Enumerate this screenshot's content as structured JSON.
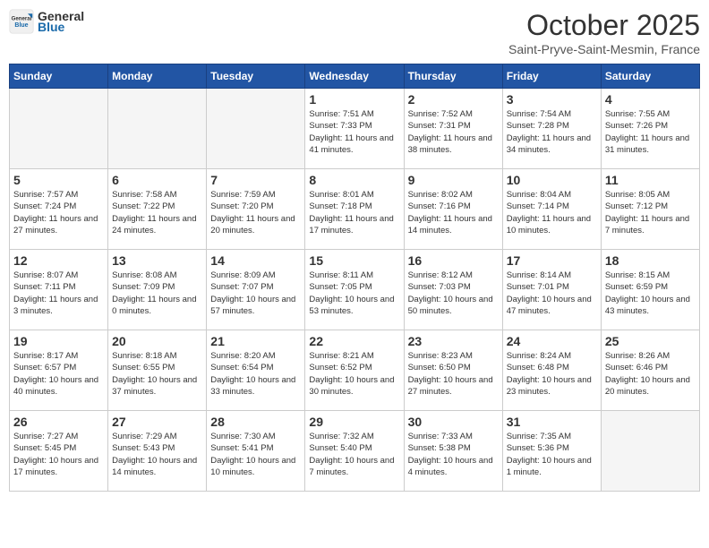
{
  "header": {
    "logo_general": "General",
    "logo_blue": "Blue",
    "title": "October 2025",
    "subtitle": "Saint-Pryve-Saint-Mesmin, France"
  },
  "days_of_week": [
    "Sunday",
    "Monday",
    "Tuesday",
    "Wednesday",
    "Thursday",
    "Friday",
    "Saturday"
  ],
  "weeks": [
    [
      {
        "num": "",
        "info": ""
      },
      {
        "num": "",
        "info": ""
      },
      {
        "num": "",
        "info": ""
      },
      {
        "num": "1",
        "info": "Sunrise: 7:51 AM\nSunset: 7:33 PM\nDaylight: 11 hours and 41 minutes."
      },
      {
        "num": "2",
        "info": "Sunrise: 7:52 AM\nSunset: 7:31 PM\nDaylight: 11 hours and 38 minutes."
      },
      {
        "num": "3",
        "info": "Sunrise: 7:54 AM\nSunset: 7:28 PM\nDaylight: 11 hours and 34 minutes."
      },
      {
        "num": "4",
        "info": "Sunrise: 7:55 AM\nSunset: 7:26 PM\nDaylight: 11 hours and 31 minutes."
      }
    ],
    [
      {
        "num": "5",
        "info": "Sunrise: 7:57 AM\nSunset: 7:24 PM\nDaylight: 11 hours and 27 minutes."
      },
      {
        "num": "6",
        "info": "Sunrise: 7:58 AM\nSunset: 7:22 PM\nDaylight: 11 hours and 24 minutes."
      },
      {
        "num": "7",
        "info": "Sunrise: 7:59 AM\nSunset: 7:20 PM\nDaylight: 11 hours and 20 minutes."
      },
      {
        "num": "8",
        "info": "Sunrise: 8:01 AM\nSunset: 7:18 PM\nDaylight: 11 hours and 17 minutes."
      },
      {
        "num": "9",
        "info": "Sunrise: 8:02 AM\nSunset: 7:16 PM\nDaylight: 11 hours and 14 minutes."
      },
      {
        "num": "10",
        "info": "Sunrise: 8:04 AM\nSunset: 7:14 PM\nDaylight: 11 hours and 10 minutes."
      },
      {
        "num": "11",
        "info": "Sunrise: 8:05 AM\nSunset: 7:12 PM\nDaylight: 11 hours and 7 minutes."
      }
    ],
    [
      {
        "num": "12",
        "info": "Sunrise: 8:07 AM\nSunset: 7:11 PM\nDaylight: 11 hours and 3 minutes."
      },
      {
        "num": "13",
        "info": "Sunrise: 8:08 AM\nSunset: 7:09 PM\nDaylight: 11 hours and 0 minutes."
      },
      {
        "num": "14",
        "info": "Sunrise: 8:09 AM\nSunset: 7:07 PM\nDaylight: 10 hours and 57 minutes."
      },
      {
        "num": "15",
        "info": "Sunrise: 8:11 AM\nSunset: 7:05 PM\nDaylight: 10 hours and 53 minutes."
      },
      {
        "num": "16",
        "info": "Sunrise: 8:12 AM\nSunset: 7:03 PM\nDaylight: 10 hours and 50 minutes."
      },
      {
        "num": "17",
        "info": "Sunrise: 8:14 AM\nSunset: 7:01 PM\nDaylight: 10 hours and 47 minutes."
      },
      {
        "num": "18",
        "info": "Sunrise: 8:15 AM\nSunset: 6:59 PM\nDaylight: 10 hours and 43 minutes."
      }
    ],
    [
      {
        "num": "19",
        "info": "Sunrise: 8:17 AM\nSunset: 6:57 PM\nDaylight: 10 hours and 40 minutes."
      },
      {
        "num": "20",
        "info": "Sunrise: 8:18 AM\nSunset: 6:55 PM\nDaylight: 10 hours and 37 minutes."
      },
      {
        "num": "21",
        "info": "Sunrise: 8:20 AM\nSunset: 6:54 PM\nDaylight: 10 hours and 33 minutes."
      },
      {
        "num": "22",
        "info": "Sunrise: 8:21 AM\nSunset: 6:52 PM\nDaylight: 10 hours and 30 minutes."
      },
      {
        "num": "23",
        "info": "Sunrise: 8:23 AM\nSunset: 6:50 PM\nDaylight: 10 hours and 27 minutes."
      },
      {
        "num": "24",
        "info": "Sunrise: 8:24 AM\nSunset: 6:48 PM\nDaylight: 10 hours and 23 minutes."
      },
      {
        "num": "25",
        "info": "Sunrise: 8:26 AM\nSunset: 6:46 PM\nDaylight: 10 hours and 20 minutes."
      }
    ],
    [
      {
        "num": "26",
        "info": "Sunrise: 7:27 AM\nSunset: 5:45 PM\nDaylight: 10 hours and 17 minutes."
      },
      {
        "num": "27",
        "info": "Sunrise: 7:29 AM\nSunset: 5:43 PM\nDaylight: 10 hours and 14 minutes."
      },
      {
        "num": "28",
        "info": "Sunrise: 7:30 AM\nSunset: 5:41 PM\nDaylight: 10 hours and 10 minutes."
      },
      {
        "num": "29",
        "info": "Sunrise: 7:32 AM\nSunset: 5:40 PM\nDaylight: 10 hours and 7 minutes."
      },
      {
        "num": "30",
        "info": "Sunrise: 7:33 AM\nSunset: 5:38 PM\nDaylight: 10 hours and 4 minutes."
      },
      {
        "num": "31",
        "info": "Sunrise: 7:35 AM\nSunset: 5:36 PM\nDaylight: 10 hours and 1 minute."
      },
      {
        "num": "",
        "info": ""
      }
    ]
  ]
}
